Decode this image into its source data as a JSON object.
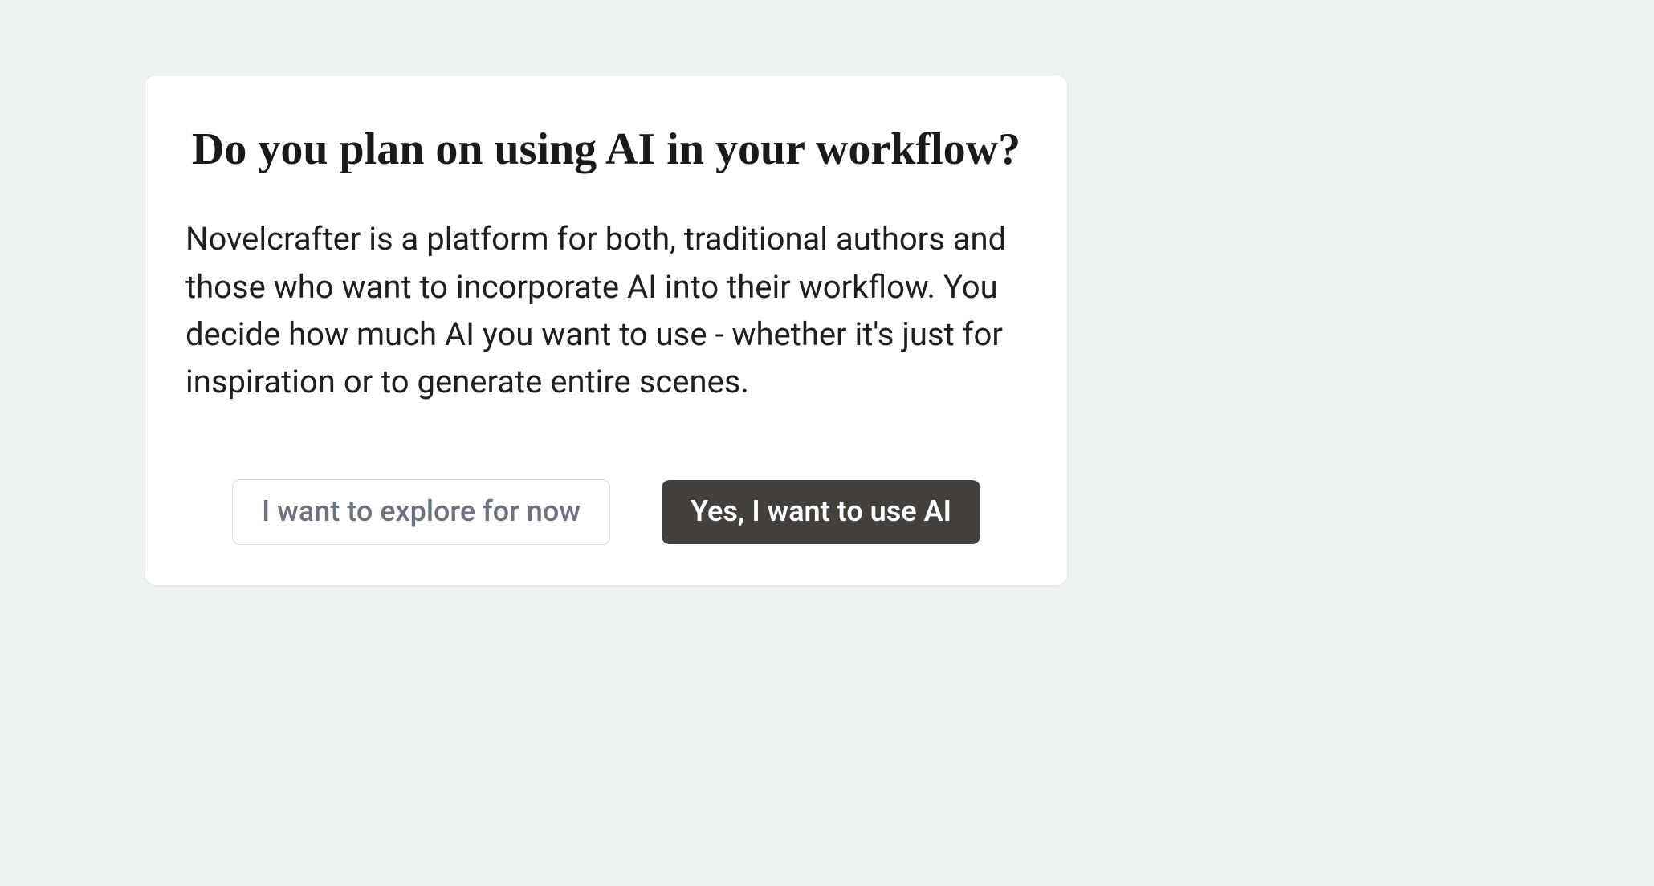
{
  "dialog": {
    "heading": "Do you plan on using AI in your workflow?",
    "body": "Novelcrafter is a platform for both, traditional authors and those who want to incorporate AI into their workflow. You decide how much AI you want to use - whether it's just for inspiration or to generate entire scenes.",
    "buttons": {
      "secondary": "I want to explore for now",
      "primary": "Yes, I want to use AI"
    }
  }
}
